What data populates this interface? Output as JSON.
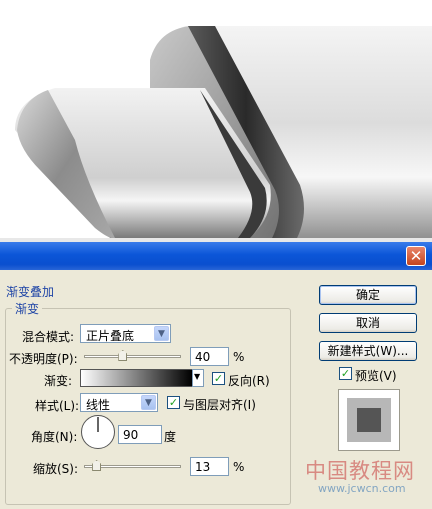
{
  "dialog": {
    "close_glyph": "✕",
    "section_title": "渐变叠加",
    "group_title": "渐变",
    "blend_mode": {
      "label": "混合模式:",
      "value": "正片叠底"
    },
    "opacity": {
      "label": "不透明度(P):",
      "value": "40",
      "unit": "%",
      "level": 0.4
    },
    "gradient": {
      "label": "渐变:",
      "reverse_label": "反向(R)",
      "reverse_checked": true
    },
    "style": {
      "label": "样式(L):",
      "value": "线性",
      "align_label": "与图层对齐(I)",
      "align_checked": true
    },
    "angle": {
      "label": "角度(N):",
      "value": "90",
      "unit": "度"
    },
    "scale": {
      "label": "缩放(S):",
      "value": "13",
      "unit": "%",
      "level": 0.13
    },
    "buttons": {
      "ok": "确定",
      "cancel": "取消",
      "new_style": "新建样式(W)..."
    },
    "preview": {
      "label": "预览(V)",
      "checked": true
    }
  },
  "watermark": {
    "text": "中国教程网",
    "url": "www.jcwcn.com"
  },
  "colors": {
    "titlebar": "#0b56d8",
    "dialog_bg": "#ece9d8",
    "check": "#21a121",
    "label_blue": "#1f45a6"
  }
}
